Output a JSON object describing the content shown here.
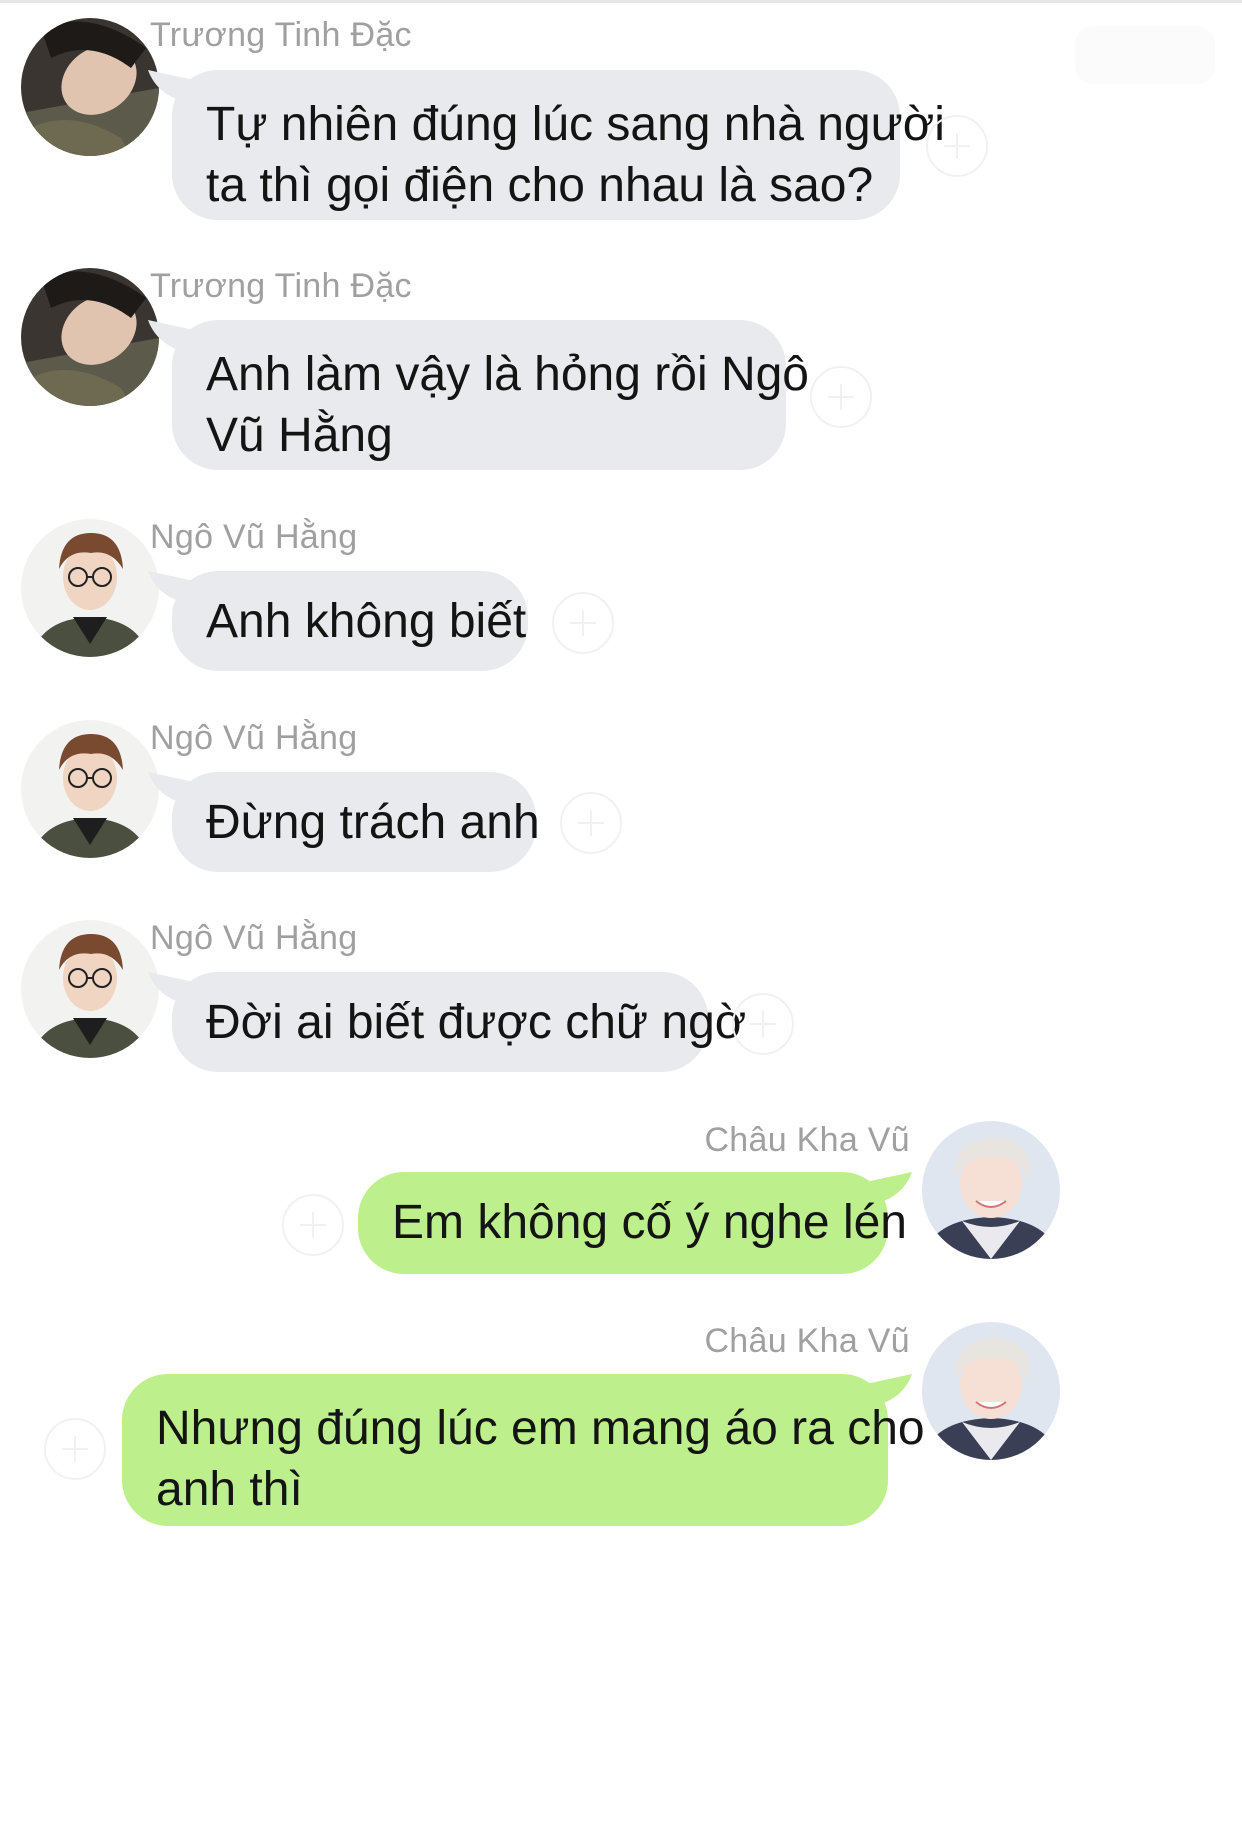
{
  "messages": [
    {
      "sender": "Trương Tinh Đặc",
      "direction": "incoming",
      "avatar": "avatar-truong-tinh-dac",
      "lines": [
        "Tự nhiên đúng lúc sang nhà người",
        "ta thì gọi điện cho nhau là sao?"
      ]
    },
    {
      "sender": "Trương Tinh Đặc",
      "direction": "incoming",
      "avatar": "avatar-truong-tinh-dac",
      "lines": [
        "Anh làm vậy là hỏng rồi Ngô",
        "Vũ Hằng"
      ]
    },
    {
      "sender": "Ngô Vũ Hằng",
      "direction": "incoming",
      "avatar": "avatar-ngo-vu-hang",
      "lines": [
        "Anh không biết"
      ]
    },
    {
      "sender": "Ngô Vũ Hằng",
      "direction": "incoming",
      "avatar": "avatar-ngo-vu-hang",
      "lines": [
        "Đừng trách anh"
      ]
    },
    {
      "sender": "Ngô Vũ Hằng",
      "direction": "incoming",
      "avatar": "avatar-ngo-vu-hang",
      "lines": [
        "Đời ai biết được chữ ngờ"
      ]
    },
    {
      "sender": "Châu Kha Vũ",
      "direction": "outgoing",
      "avatar": "avatar-chau-kha-vu",
      "lines": [
        "Em không cố ý nghe lén"
      ]
    },
    {
      "sender": "Châu Kha Vũ",
      "direction": "outgoing",
      "avatar": "avatar-chau-kha-vu",
      "lines": [
        "Nhưng đúng lúc em mang áo ra cho",
        "anh thì"
      ]
    }
  ],
  "colors": {
    "incoming_bubble": "#e8eaed",
    "outgoing_bubble": "#bdf08c",
    "sender_name": "#a0a0a0",
    "message_text": "#141414"
  },
  "icons": {
    "reaction": "add-reaction-icon"
  }
}
